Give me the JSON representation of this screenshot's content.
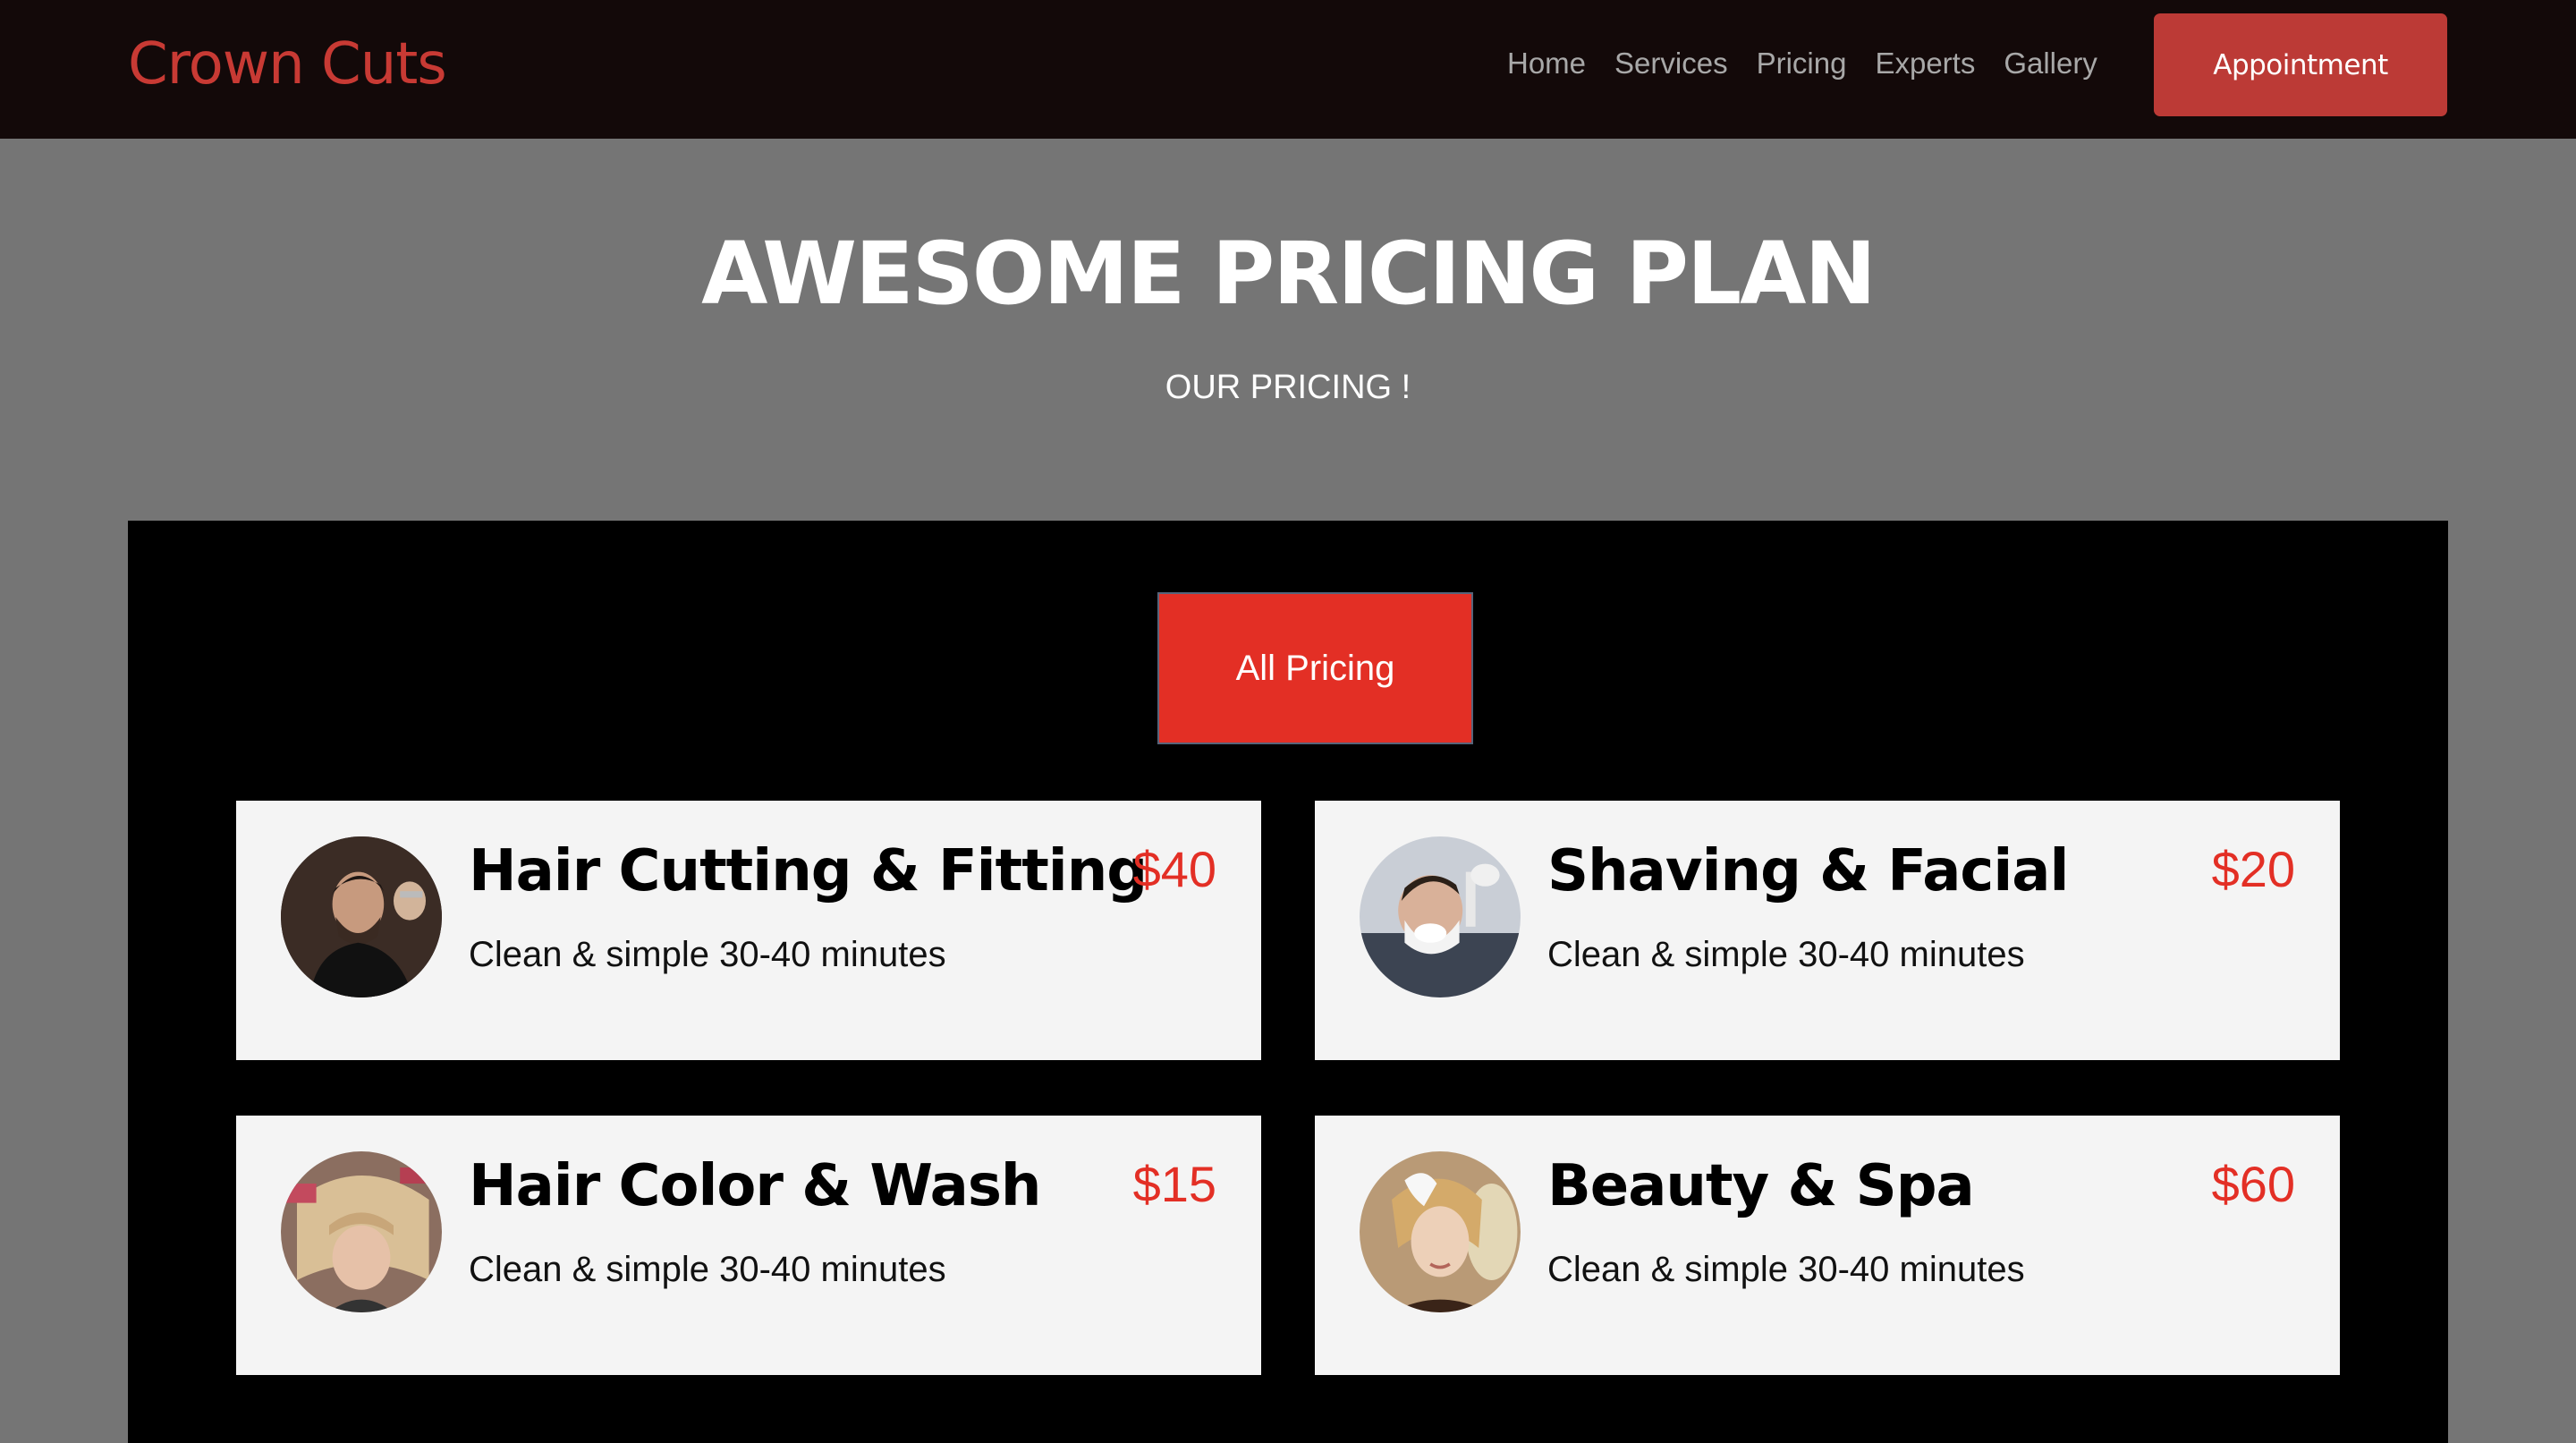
{
  "header": {
    "brand": "Crown Cuts",
    "nav": [
      {
        "label": "Home"
      },
      {
        "label": "Services"
      },
      {
        "label": "Pricing"
      },
      {
        "label": "Experts"
      },
      {
        "label": "Gallery"
      }
    ],
    "cta_label": "Appointment"
  },
  "hero": {
    "title": "AWESOME PRICING PLAN",
    "subtitle": "OUR PRICING !"
  },
  "pricing": {
    "filter_label": "All Pricing",
    "items": [
      {
        "title": "Hair Cutting & Fitting",
        "price": "$40",
        "description": "Clean & simple 30-40 minutes",
        "image": "barber-haircut-photo"
      },
      {
        "title": "Shaving & Facial",
        "price": "$20",
        "description": "Clean & simple 30-40 minutes",
        "image": "beard-shave-photo"
      },
      {
        "title": "Hair Color & Wash",
        "price": "$15",
        "description": "Clean & simple 30-40 minutes",
        "image": "hair-color-photo"
      },
      {
        "title": "Beauty & Spa",
        "price": "$60",
        "description": "Clean & simple 30-40 minutes",
        "image": "spa-facial-photo"
      }
    ]
  },
  "colors": {
    "accent": "#e32f25",
    "brand": "#c83a34",
    "nav_bg": "#130909",
    "page_bg": "#757575",
    "card_bg": "#f4f4f4"
  }
}
